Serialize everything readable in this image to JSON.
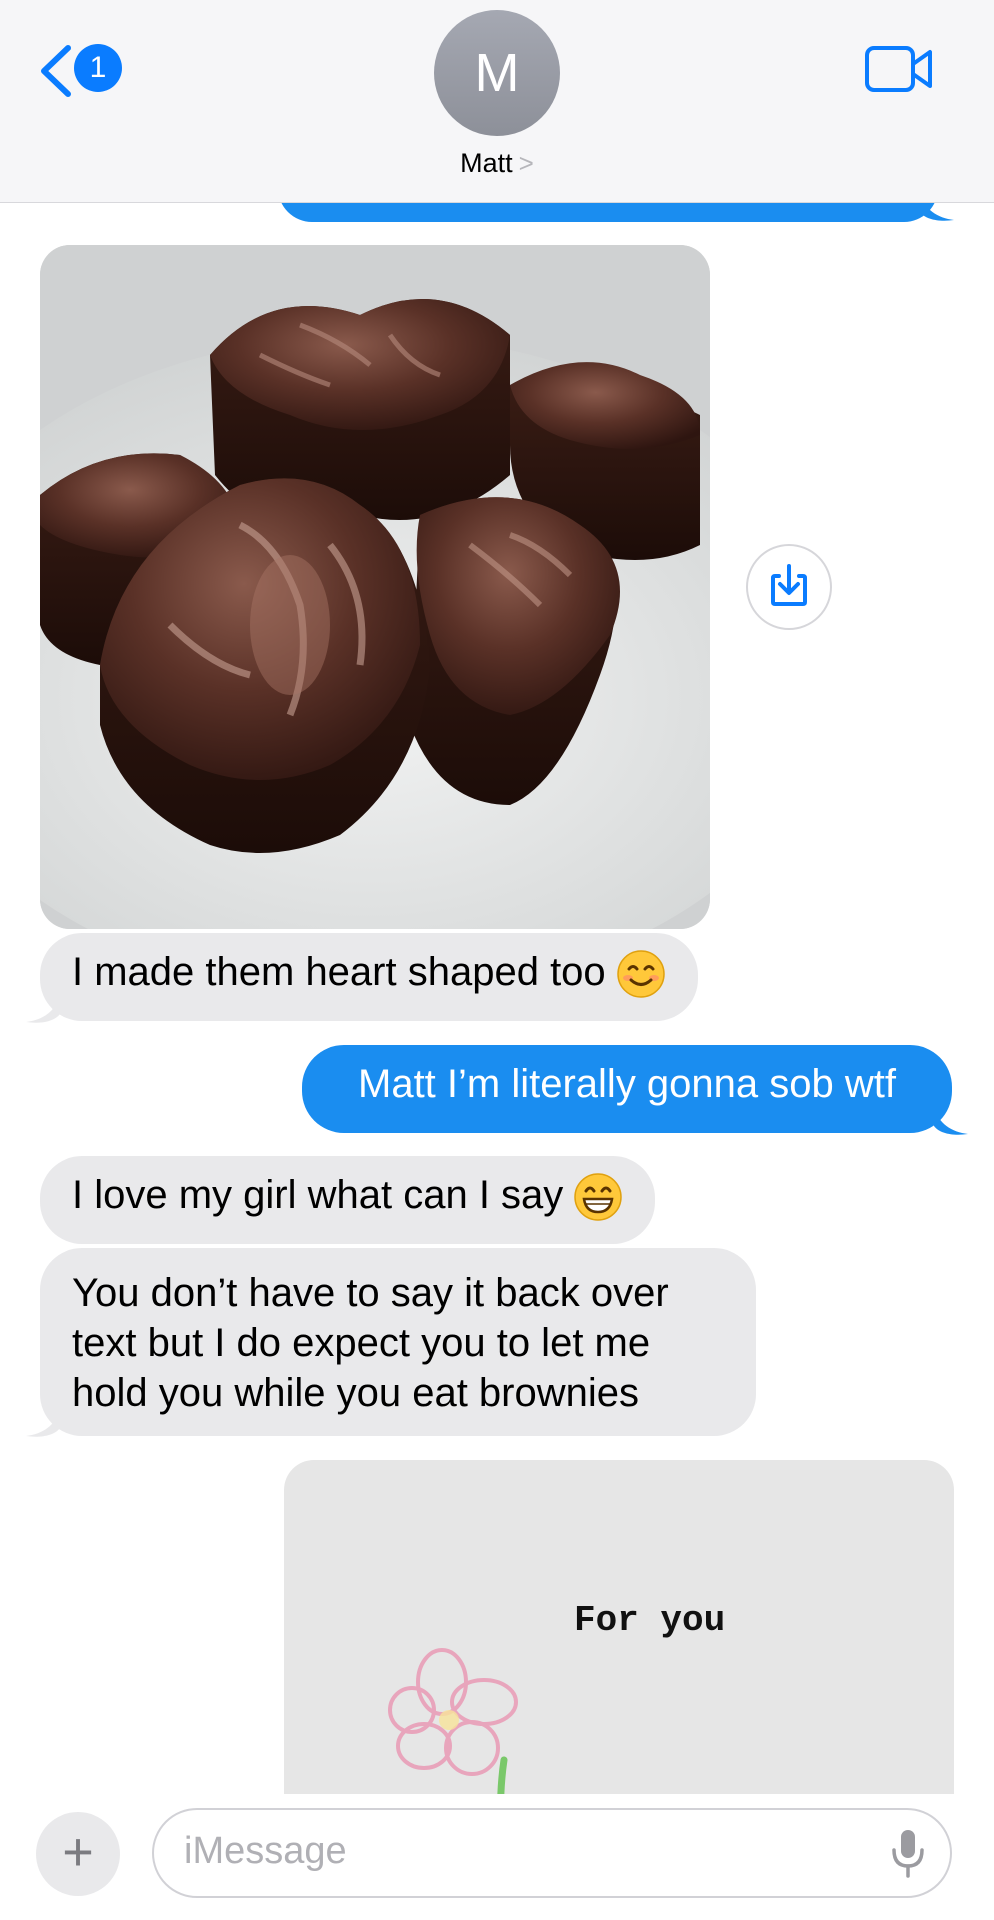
{
  "header": {
    "back_badge": "1",
    "avatar_initial": "M",
    "contact_name": "Matt",
    "contact_chevron": ">"
  },
  "icons": {
    "back": "chevron-left-icon",
    "video": "video-camera-icon",
    "save": "save-download-icon",
    "add": "plus-icon",
    "mic": "microphone-icon"
  },
  "messages": [
    {
      "type": "image",
      "direction": "received",
      "subject": "heart shaped brownies on a plate"
    },
    {
      "type": "text",
      "direction": "received",
      "text": "I made them heart shaped too",
      "emoji": "smiling-face-icon"
    },
    {
      "type": "text",
      "direction": "sent",
      "text": "Matt I’m literally gonna sob wtf"
    },
    {
      "type": "text",
      "direction": "received",
      "text": "I love my girl what can I say",
      "emoji": "grinning-face-icon"
    },
    {
      "type": "text",
      "direction": "received",
      "lines": [
        "You don’t have to say it back over",
        "text but I do expect you to let me",
        "hold you while you eat brownies"
      ]
    },
    {
      "type": "image",
      "direction": "sent",
      "caption": "For you"
    }
  ],
  "input": {
    "plus_label": "+",
    "placeholder": "iMessage"
  },
  "colors": {
    "sent_bubble": "#1a8df0",
    "received_bubble": "#e9e9eb",
    "accent": "#0a7cff",
    "header_bg": "#f6f6f8"
  }
}
